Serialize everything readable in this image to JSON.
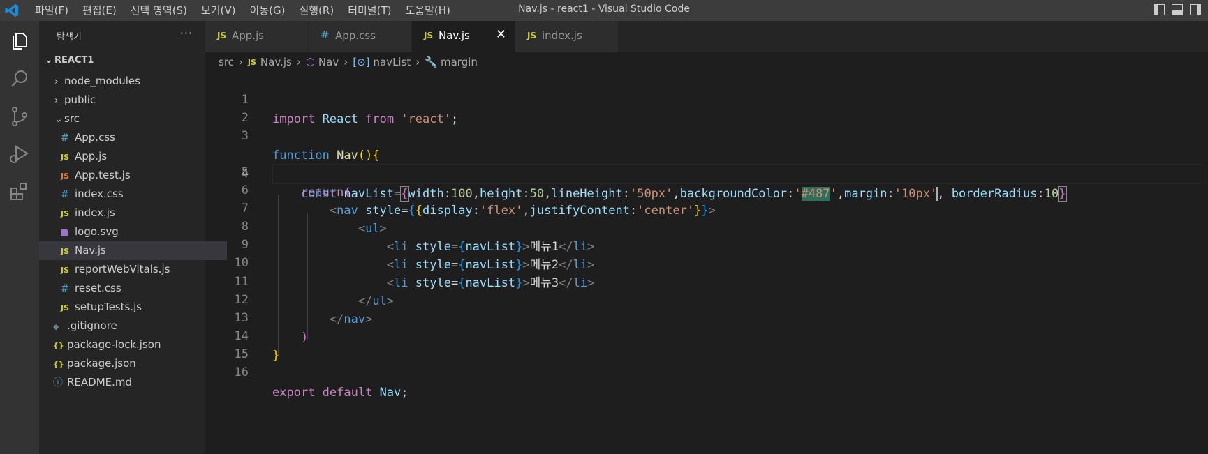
{
  "titlebar": {
    "menu": [
      "파일(F)",
      "편집(E)",
      "선택 영역(S)",
      "보기(V)",
      "이동(G)",
      "실행(R)",
      "터미널(T)",
      "도움말(H)"
    ],
    "title": "Nav.js - react1 - Visual Studio Code",
    "accent": "#007acc"
  },
  "sidebar": {
    "title": "탐색기",
    "more": "···",
    "root": "REACT1",
    "items": [
      {
        "label": "node_modules",
        "icon": "chevron-right-icon"
      },
      {
        "label": "public",
        "icon": "chevron-right-icon"
      },
      {
        "label": "src",
        "icon": "chevron-down-icon"
      },
      {
        "label": "App.css",
        "icon": "css-icon",
        "badge": "#"
      },
      {
        "label": "App.js",
        "icon": "js-icon",
        "badge": "JS"
      },
      {
        "label": "App.test.js",
        "icon": "js-test-icon",
        "badge": "JS"
      },
      {
        "label": "index.css",
        "icon": "css-icon",
        "badge": "#"
      },
      {
        "label": "index.js",
        "icon": "js-icon",
        "badge": "JS"
      },
      {
        "label": "logo.svg",
        "icon": "svg-icon",
        "badge": ""
      },
      {
        "label": "Nav.js",
        "icon": "js-icon",
        "badge": "JS"
      },
      {
        "label": "reportWebVitals.js",
        "icon": "js-icon",
        "badge": "JS"
      },
      {
        "label": "reset.css",
        "icon": "css-icon",
        "badge": "#"
      },
      {
        "label": "setupTests.js",
        "icon": "js-icon",
        "badge": "JS"
      },
      {
        "label": ".gitignore",
        "icon": "git-icon",
        "badge": "◆"
      },
      {
        "label": "package-lock.json",
        "icon": "json-icon",
        "badge": "{}"
      },
      {
        "label": "package.json",
        "icon": "json-icon",
        "badge": "{}"
      },
      {
        "label": "README.md",
        "icon": "info-icon",
        "badge": "ⓘ"
      }
    ]
  },
  "tabs": [
    {
      "label": "App.js",
      "badge": "JS"
    },
    {
      "label": "App.css",
      "badge": "#"
    },
    {
      "label": "Nav.js",
      "badge": "JS",
      "close": "✕"
    },
    {
      "label": "index.js",
      "badge": "JS"
    }
  ],
  "breadcrumb": [
    "src",
    "Nav.js",
    "Nav",
    "navList",
    "margin"
  ],
  "editor": {
    "line_numbers": [
      "1",
      "2",
      "3",
      "4",
      "5",
      "6",
      "7",
      "8",
      "9",
      "10",
      "11",
      "12",
      "13",
      "14",
      "15",
      "16"
    ],
    "lines": [
      "import React from 'react';",
      "",
      "function Nav(){",
      "    const navList={width:100,height:50,lineHeight:'50px',backgroundColor:'#487',margin:'10px', borderRadius:10}",
      "    return(",
      "        <nav style={{display:'flex',justifyContent:'center'}}>",
      "            <ul>",
      "                <li style={navList}>메뉴1</li>",
      "                <li style={navList}>메뉴2</li>",
      "                <li style={navList}>메뉴3</li>",
      "            </ul>",
      "        </nav>",
      "    )",
      "}",
      "",
      "export default Nav;"
    ]
  }
}
